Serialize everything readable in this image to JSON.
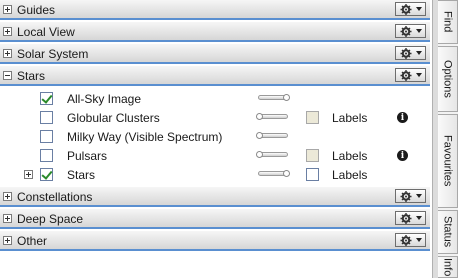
{
  "sections": [
    {
      "title": "Guides",
      "expanded": false
    },
    {
      "title": "Local View",
      "expanded": false
    },
    {
      "title": "Solar System",
      "expanded": false
    },
    {
      "title": "Stars",
      "expanded": true
    },
    {
      "title": "Constellations",
      "expanded": false
    },
    {
      "title": "Deep Space",
      "expanded": false
    },
    {
      "title": "Other",
      "expanded": false
    }
  ],
  "stars_items": [
    {
      "label": "All-Sky Image",
      "checked": true,
      "slider": "on",
      "labels_text": "",
      "info": false,
      "expandable": false
    },
    {
      "label": "Globular Clusters",
      "checked": false,
      "slider": "off",
      "labels_text": "Labels",
      "labels_checked": false,
      "labels_disabled": true,
      "info": true,
      "expandable": false
    },
    {
      "label": "Milky Way (Visible Spectrum)",
      "checked": false,
      "slider": "off",
      "labels_text": "",
      "info": false,
      "expandable": false
    },
    {
      "label": "Pulsars",
      "checked": false,
      "slider": "off",
      "labels_text": "Labels",
      "labels_checked": false,
      "labels_disabled": true,
      "info": true,
      "expandable": false
    },
    {
      "label": "Stars",
      "checked": true,
      "slider": "on",
      "labels_text": "Labels",
      "labels_checked": false,
      "labels_disabled": false,
      "info": false,
      "expandable": true
    }
  ],
  "info_symbol": "i",
  "side_tabs": [
    "Find",
    "Options",
    "Favourites",
    "Status",
    "Info"
  ],
  "icons": {
    "section_menu": "gear-icon",
    "expand": "plus-box-icon",
    "collapse": "minus-box-icon",
    "info": "info-icon"
  },
  "colors": {
    "header_underline": "#5a8fd0",
    "check": "#2a8a2a"
  }
}
